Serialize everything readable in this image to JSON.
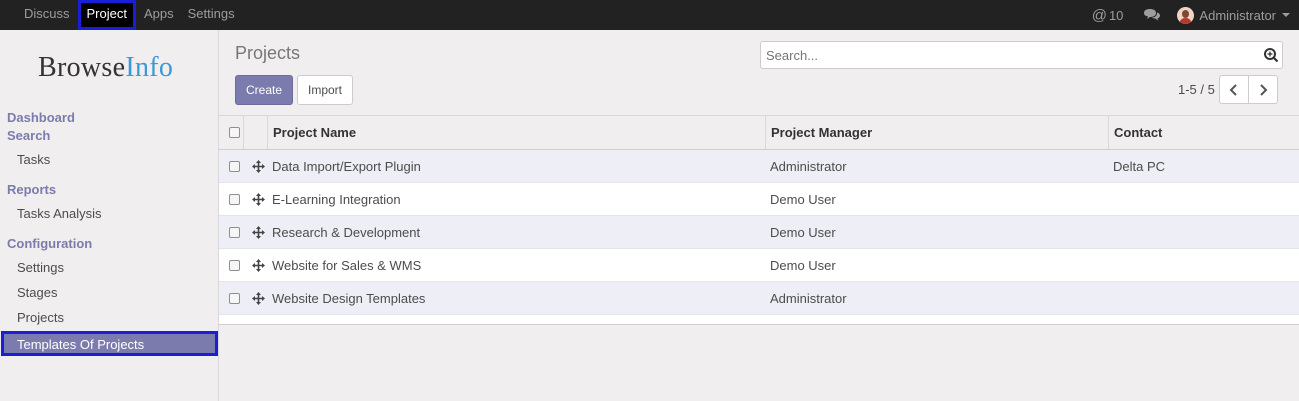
{
  "topbar": {
    "menu": [
      {
        "label": "Discuss"
      },
      {
        "label": "Project"
      },
      {
        "label": "Apps"
      },
      {
        "label": "Settings"
      }
    ],
    "notifications_count": "10",
    "user_name": "Administrator"
  },
  "sidebar": {
    "logo_part1": "Browse",
    "logo_part2": "Info",
    "dashboard": "Dashboard",
    "search": "Search",
    "tasks": "Tasks",
    "reports": "Reports",
    "tasks_analysis": "Tasks Analysis",
    "configuration": "Configuration",
    "settings": "Settings",
    "stages": "Stages",
    "projects": "Projects",
    "templates": "Templates Of Projects"
  },
  "main": {
    "breadcrumb": "Projects",
    "search_placeholder": "Search...",
    "create_label": "Create",
    "import_label": "Import",
    "pager": "1-5 / 5"
  },
  "table": {
    "columns": {
      "name": "Project Name",
      "manager": "Project Manager",
      "contact": "Contact"
    },
    "rows": [
      {
        "name": "Data Import/Export Plugin",
        "manager": "Administrator",
        "contact": "Delta PC"
      },
      {
        "name": "E-Learning Integration",
        "manager": "Demo User",
        "contact": ""
      },
      {
        "name": "Research & Development",
        "manager": "Demo User",
        "contact": ""
      },
      {
        "name": "Website for Sales & WMS",
        "manager": "Demo User",
        "contact": ""
      },
      {
        "name": "Website Design Templates",
        "manager": "Administrator",
        "contact": ""
      }
    ]
  },
  "colors": {
    "accent": "#7c7bad",
    "topbar": "#222222",
    "highlight_border": "#1a1ed6"
  }
}
